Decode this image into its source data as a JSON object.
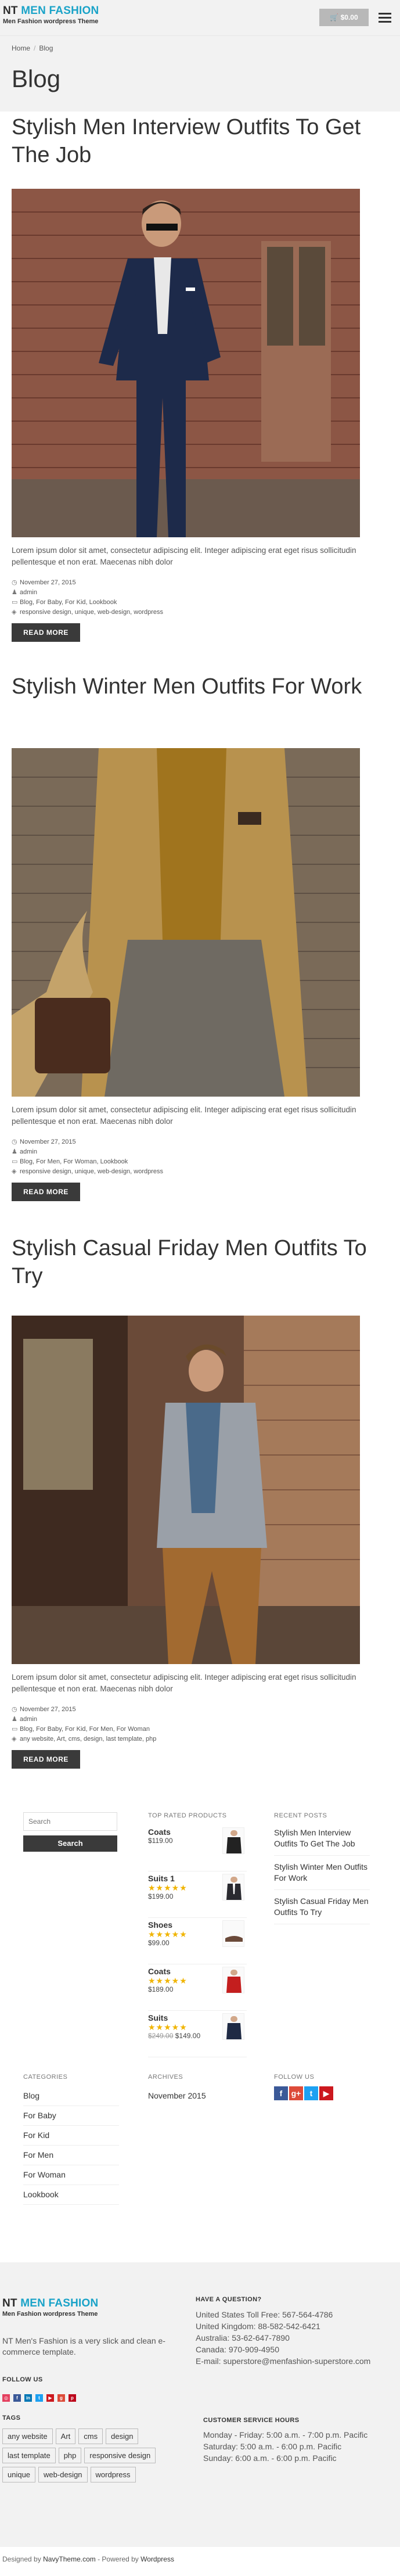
{
  "header": {
    "logo_nt": "NT",
    "logo_brand": "MEN FASHION",
    "logo_tagline": "Men Fashion wordpress Theme",
    "cart_total": "$0.00"
  },
  "breadcrumb": {
    "home": "Home",
    "current": "Blog"
  },
  "page_title": "Blog",
  "posts": [
    {
      "title": "Stylish Men Interview Outfits To Get The Job",
      "excerpt": "Lorem ipsum dolor sit amet, consectetur adipiscing elit. Integer adipiscing erat eget risus sollicitudin pellentesque et non erat. Maecenas nibh dolor",
      "date": "November 27, 2015",
      "author": "admin",
      "categories": "Blog, For Baby, For Kid, Lookbook",
      "tags": "responsive design, unique, web-design, wordpress",
      "read_more": "READ MORE"
    },
    {
      "title": "Stylish Winter Men Outfits For Work",
      "excerpt": "Lorem ipsum dolor sit amet, consectetur adipiscing elit. Integer adipiscing erat eget risus sollicitudin pellentesque et non erat. Maecenas nibh dolor",
      "date": "November 27, 2015",
      "author": "admin",
      "categories": "Blog, For Men, For Woman, Lookbook",
      "tags": "responsive design, unique, web-design, wordpress",
      "read_more": "READ MORE"
    },
    {
      "title": "Stylish Casual Friday Men Outfits To Try",
      "excerpt": "Lorem ipsum dolor sit amet, consectetur adipiscing elit. Integer adipiscing erat eget risus sollicitudin pellentesque et non erat. Maecenas nibh dolor",
      "date": "November 27, 2015",
      "author": "admin",
      "categories": "Blog, For Baby, For Kid, For Men, For Woman",
      "tags": "any website, Art, cms, design, last template, php",
      "read_more": "READ MORE"
    }
  ],
  "sidebar": {
    "search_placeholder": "Search",
    "search_button": "Search",
    "top_rated_title": "TOP RATED PRODUCTS",
    "products": [
      {
        "name": "Coats",
        "price": "$119.00",
        "old_price": "",
        "stars": ""
      },
      {
        "name": "Suits 1",
        "price": "$199.00",
        "old_price": "",
        "stars": "★★★★★"
      },
      {
        "name": "Shoes",
        "price": "$99.00",
        "old_price": "",
        "stars": "★★★★★"
      },
      {
        "name": "Coats",
        "price": "$189.00",
        "old_price": "",
        "stars": "★★★★★"
      },
      {
        "name": "Suits",
        "price": "$149.00",
        "old_price": "$249.00",
        "stars": "★★★★★"
      }
    ],
    "recent_posts_title": "RECENT POSTS",
    "recent_posts": [
      "Stylish Men Interview Outfits To Get The Job",
      "Stylish Winter Men Outfits For Work",
      "Stylish Casual Friday Men Outfits To Try"
    ],
    "categories_title": "CATEGORIES",
    "categories": [
      "Blog",
      "For Baby",
      "For Kid",
      "For Men",
      "For Woman",
      "Lookbook"
    ],
    "archives_title": "ARCHIVES",
    "archives": [
      "November 2015"
    ],
    "follow_title": "FOLLOW US"
  },
  "footer": {
    "description": "NT Men's Fashion is a very slick and clean e-commerce template.",
    "follow_title": "FOLLOW US",
    "tags_title": "TAGS",
    "tags": [
      "any website",
      "Art",
      "cms",
      "design",
      "last template",
      "php",
      "responsive design",
      "unique",
      "web-design",
      "wordpress"
    ],
    "question_title": "HAVE A QUESTION?",
    "contact_lines": [
      "United States Toll Free: 567-564-4786",
      "United Kingdom: 88-582-542-6421",
      "Australia: 53-62-647-7890",
      "Canada: 970-909-4950",
      "E-mail: superstore@menfashion-superstore.com"
    ],
    "hours_title": "CUSTOMER SERVICE HOURS",
    "hours_lines": [
      "Monday - Friday: 5:00 a.m. - 7:00 p.m. Pacific",
      "Saturday: 5:00 a.m. - 6:00 p.m. Pacific",
      "Sunday: 6:00 a.m. - 6:00 p.m. Pacific"
    ]
  },
  "copyright": {
    "prefix": "Designed by",
    "designer": "NavyTheme.com",
    "mid": " - Powered by",
    "platform": "Wordpress"
  },
  "colors": {
    "accent": "#1aa3c8",
    "button_dark": "#3a3a3a",
    "star": "#f0b400"
  }
}
